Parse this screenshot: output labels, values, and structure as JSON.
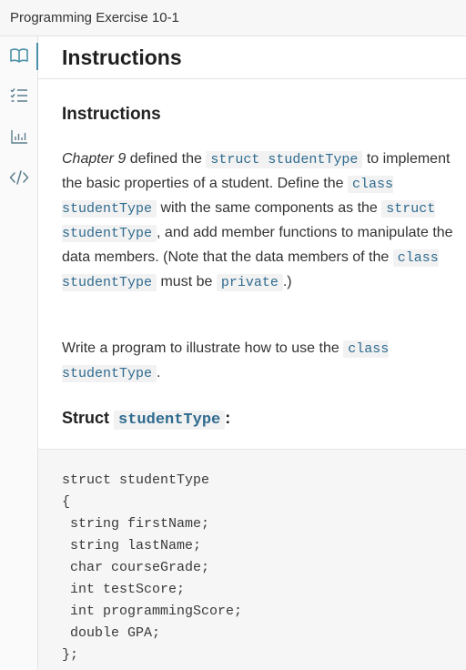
{
  "window": {
    "title": "Programming Exercise 10-1"
  },
  "sidebar": {
    "items": [
      {
        "icon": "book-icon",
        "active": true
      },
      {
        "icon": "checklist-icon",
        "active": false
      },
      {
        "icon": "bar-chart-icon",
        "active": false
      },
      {
        "icon": "code-icon",
        "active": false
      }
    ],
    "accent": "#4a90a8"
  },
  "header": {
    "title": "Instructions"
  },
  "main": {
    "section_title": "Instructions",
    "p1": {
      "t1": "Chapter 9",
      "t2": " defined the ",
      "c1": "struct studentType",
      "t3": " to implement the basic properties of a student. Define the ",
      "c2": "class studentType",
      "t4": " with the same components as the ",
      "c3": "struct studentType",
      "t5": ", and add member functions to manipulate the data members. (Note that the data members of the ",
      "c4": "class studentType",
      "t6": " must be ",
      "c5": "private",
      "t7": ".)"
    },
    "p2": {
      "t1": "Write a program to illustrate how to use the ",
      "c1": "class studentType",
      "t2": "."
    },
    "struct_heading": {
      "prefix": "Struct ",
      "code": "studentType",
      "suffix": ":"
    },
    "code_lines": [
      "struct studentType",
      "{",
      " string firstName;",
      " string lastName;",
      " char courseGrade;",
      " int testScore;",
      " int programmingScore;",
      " double GPA;",
      "};"
    ]
  }
}
